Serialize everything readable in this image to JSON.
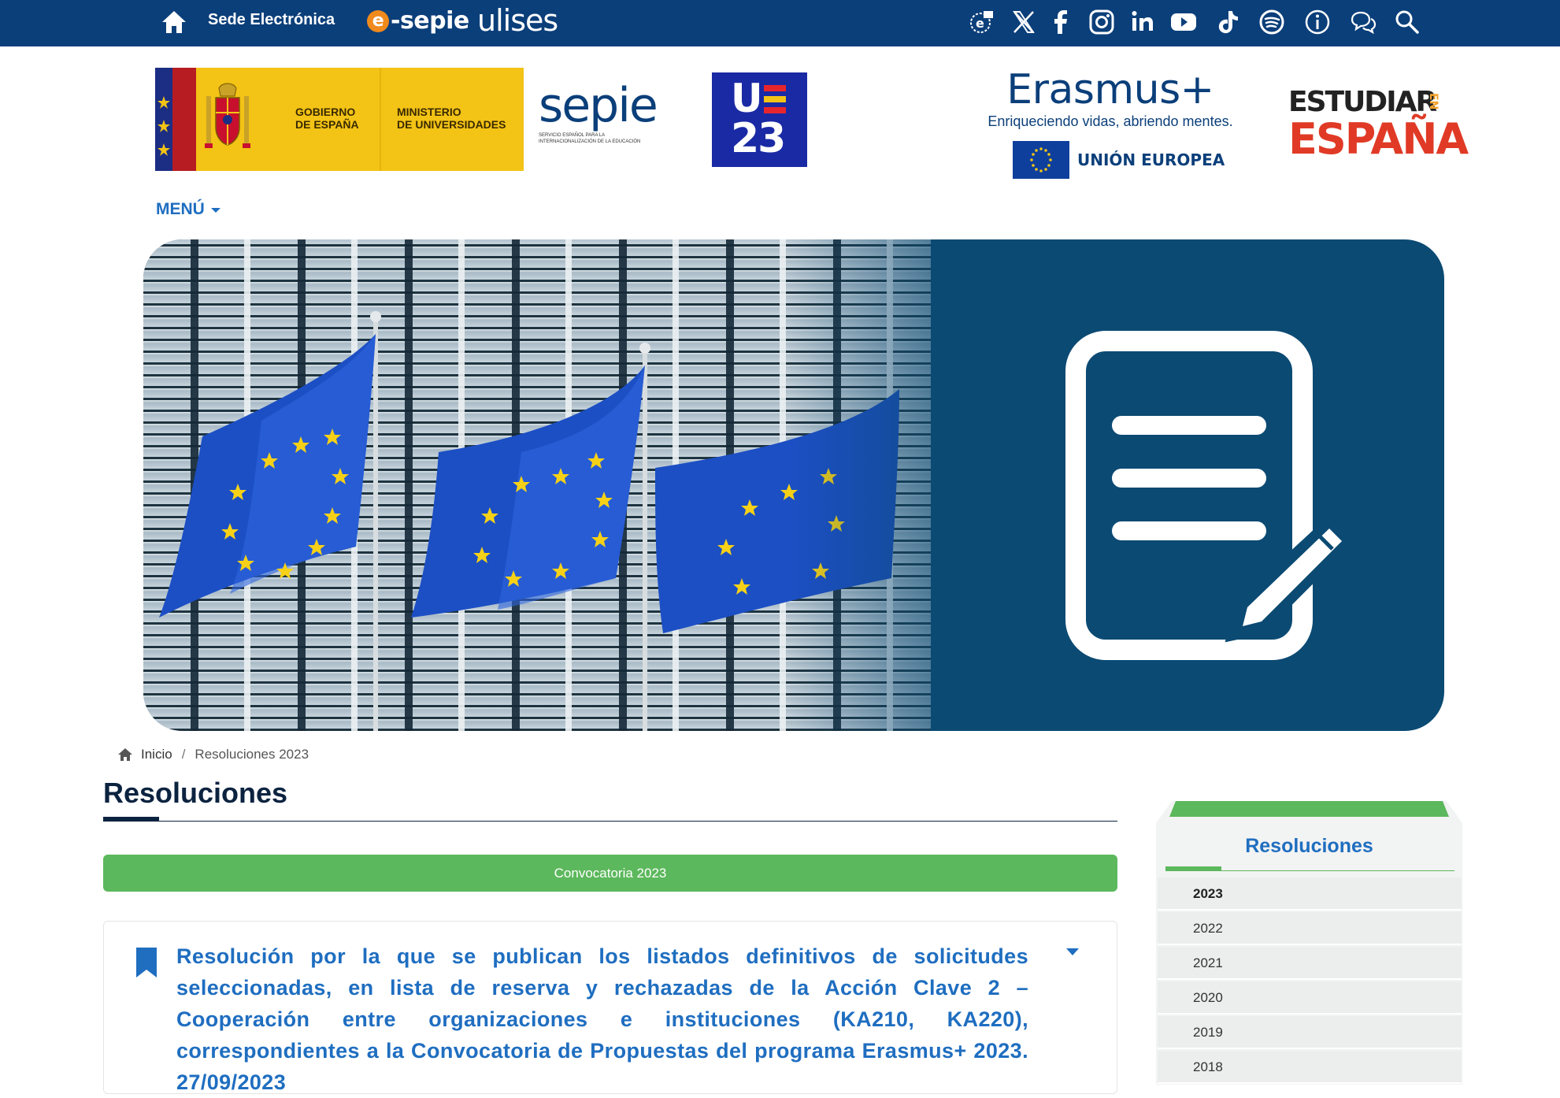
{
  "topbar": {
    "sede_label": "Sede Electrónica",
    "esepie_label": "-sepie",
    "esepie_e": "e",
    "ulises_label": "ulises",
    "social_icons": [
      "e-news-icon",
      "x-twitter-icon",
      "facebook-icon",
      "instagram-icon",
      "linkedin-icon",
      "youtube-icon",
      "tiktok-icon",
      "spotify-icon",
      "info-icon",
      "chat-icon",
      "search-icon"
    ]
  },
  "logos": {
    "gobierno": "GOBIERNO\nDE ESPAÑA",
    "gobierno_l1": "GOBIERNO",
    "gobierno_l2": "DE ESPAÑA",
    "ministerio_l1": "MINISTERIO",
    "ministerio_l2": "DE UNIVERSIDADES",
    "sepie_word": "sepie",
    "sepie_sub_l1": "SERVICIO ESPAÑOL PARA LA",
    "sepie_sub_l2": "INTERNACIONALIZACIÓN DE LA EDUCACIÓN",
    "ue_u": "U",
    "ue_23": "23",
    "erasmus_title": "Erasmus+",
    "erasmus_sub": "Enriqueciendo vidas, abriendo mentes.",
    "eu_label": "UNIÓN EUROPEA",
    "estudiar_l1": "ESTUDIAR",
    "estudiar_l2": "ESPAÑA",
    "estudiar_en": "EN"
  },
  "menu": {
    "label": "MENÚ"
  },
  "breadcrumb": {
    "home": "Inicio",
    "separator": "/",
    "current": "Resoluciones 2023"
  },
  "main": {
    "title": "Resoluciones",
    "convocatoria_label": "Convocatoria 2023",
    "card_text": "Resolución por la que se publican los listados definitivos de solicitudes seleccionadas, en lista de reserva y rechazadas de la Acción Clave 2 – Cooperación entre organizaciones e instituciones (KA210, KA220), correspondientes a la Convocatoria de Propuestas del programa Erasmus+ 2023. 27/09/2023"
  },
  "sidebar": {
    "title": "Resoluciones",
    "years": [
      "2023",
      "2022",
      "2021",
      "2020",
      "2019",
      "2018"
    ],
    "active_year": "2023"
  },
  "colors": {
    "topbar": "#0b3f7a",
    "accent_blue": "#1f6ec0",
    "green": "#5cb85c",
    "title_navy": "#0c2340"
  }
}
